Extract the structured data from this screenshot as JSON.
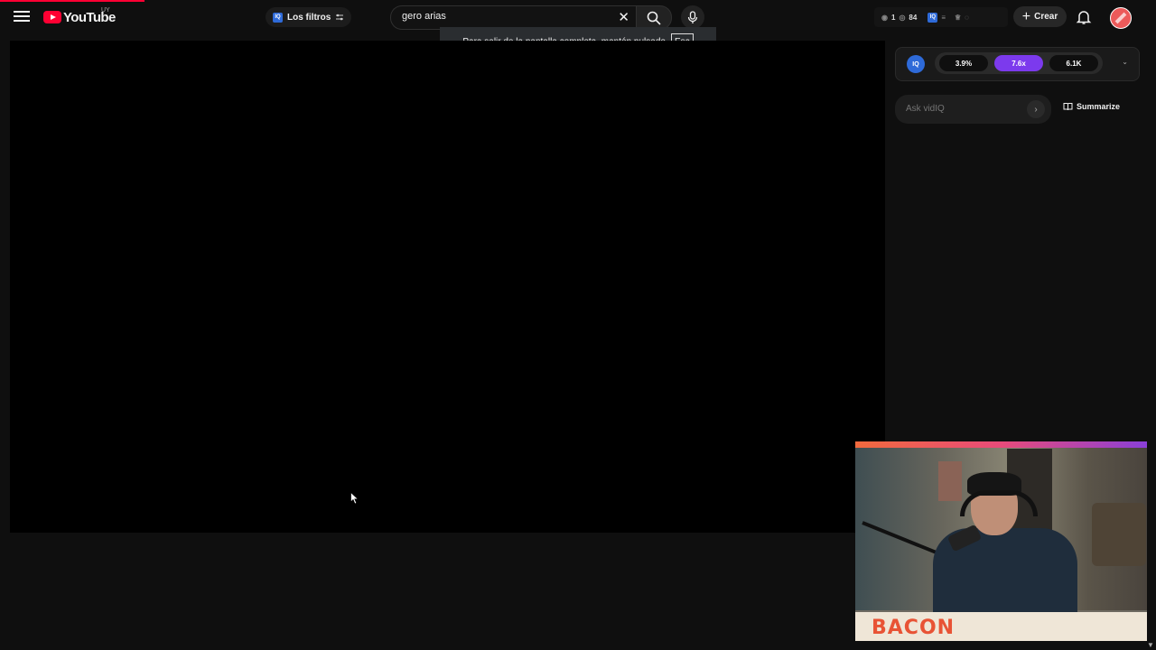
{
  "header": {
    "logo_text": "YouTube",
    "region_code": "UY",
    "filters_label": "Los filtros",
    "search": {
      "value": "gero arias",
      "placeholder": ""
    },
    "stats": {
      "likes": "1",
      "views": "84"
    },
    "create_label": "Crear"
  },
  "toast": {
    "message": "Para salir de la pantalla completa, mantén pulsado",
    "key": "Esc"
  },
  "vidiq": {
    "logo_text": "IQ",
    "filters_logo_text": "IQ",
    "metrics": [
      "3.9%",
      "7.6x",
      "6.1K"
    ],
    "ask_placeholder": "Ask vidIQ",
    "summarize_label": "Summarize"
  },
  "webcam": {
    "banner_text": "BACON"
  },
  "colors": {
    "brand_red": "#ff0033",
    "vidiq_blue": "#2e6ad8",
    "active_metric": "#7c3aed",
    "banner_text": "#e85335"
  },
  "icons": [
    "menu-icon",
    "youtube-logo-icon",
    "filter-icon",
    "clear-icon",
    "search-icon",
    "mic-icon",
    "eye-icon",
    "bell-icon",
    "book-icon",
    "chevron-down-icon",
    "chevron-right-icon"
  ]
}
